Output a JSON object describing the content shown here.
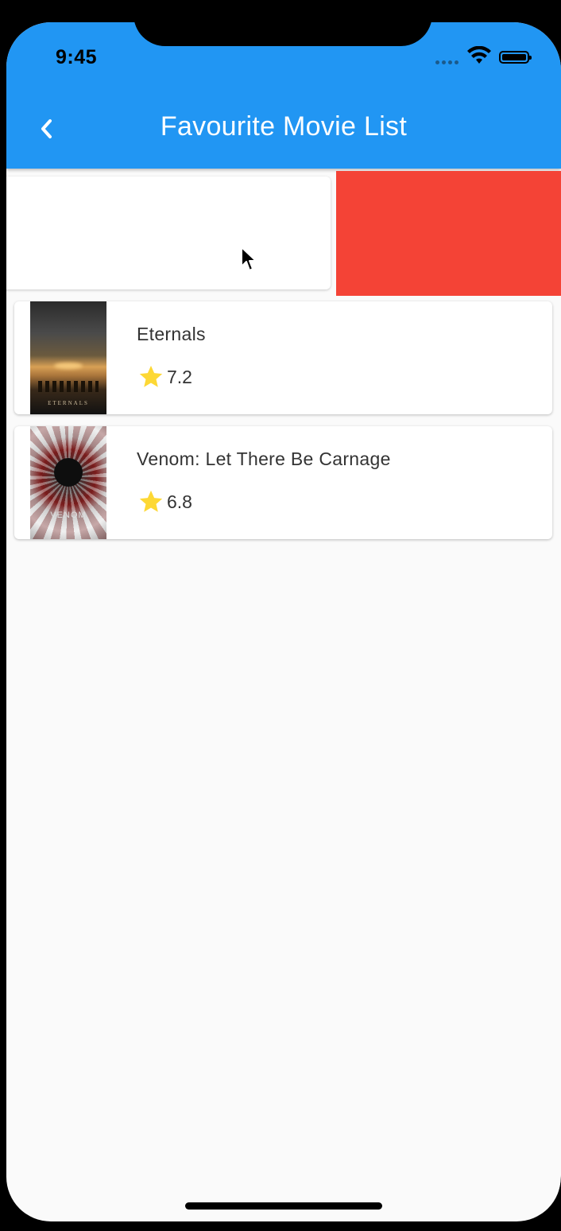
{
  "status_bar": {
    "time": "9:45"
  },
  "app_bar": {
    "title": "Favourite Movie List",
    "back_icon": "chevron-left-icon"
  },
  "colors": {
    "app_bar": "#2196f3",
    "delete_background": "#f44336",
    "star": "#fdd835"
  },
  "movies": [
    {
      "title": "Eternals",
      "rating": "7.2",
      "poster_text": "ETERNALS"
    },
    {
      "title": "Venom: Let There Be Carnage",
      "rating": "6.8",
      "poster_text": "VENOM"
    }
  ]
}
